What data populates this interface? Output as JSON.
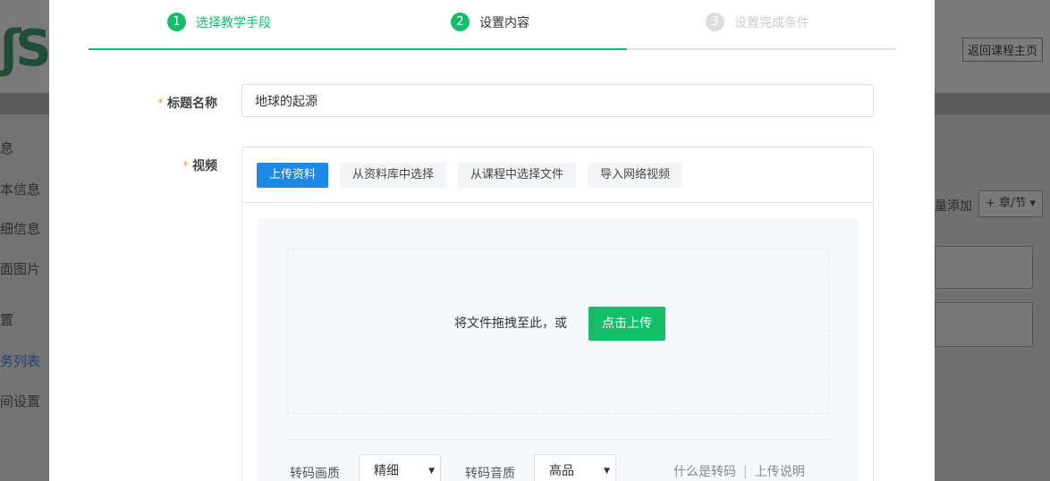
{
  "background": {
    "return_button": "返回课程主页",
    "sidebar_items": [
      "息",
      "本信息",
      "细信息",
      "面图片",
      "置",
      "务列表",
      "间设置"
    ],
    "batch_add": "量添加",
    "chapter_button": "+ 章/节 ▾"
  },
  "steps": [
    {
      "number": "1",
      "label": "选择教学手段",
      "state": "done"
    },
    {
      "number": "2",
      "label": "设置内容",
      "state": "current"
    },
    {
      "number": "3",
      "label": "设置完成条件",
      "state": "pending"
    }
  ],
  "form": {
    "title_label": "标题名称",
    "title_value": "地球的起源",
    "video_label": "视频",
    "required_mark": "*"
  },
  "video": {
    "tabs": [
      "上传资料",
      "从资料库中选择",
      "从课程中选择文件",
      "导入网络视频"
    ],
    "active_tab": 0,
    "drop_text": "将文件拖拽至此，或",
    "upload_button": "点击上传",
    "video_quality_label": "转码画质",
    "video_quality_value": "精细",
    "audio_quality_label": "转码音质",
    "audio_quality_value": "高品",
    "help_what": "什么是转码",
    "help_sep": "|",
    "help_upload": "上传说明"
  },
  "colors": {
    "accent_green": "#13bd6a",
    "tab_blue": "#1e88e5",
    "required_orange": "#f0a04b"
  }
}
